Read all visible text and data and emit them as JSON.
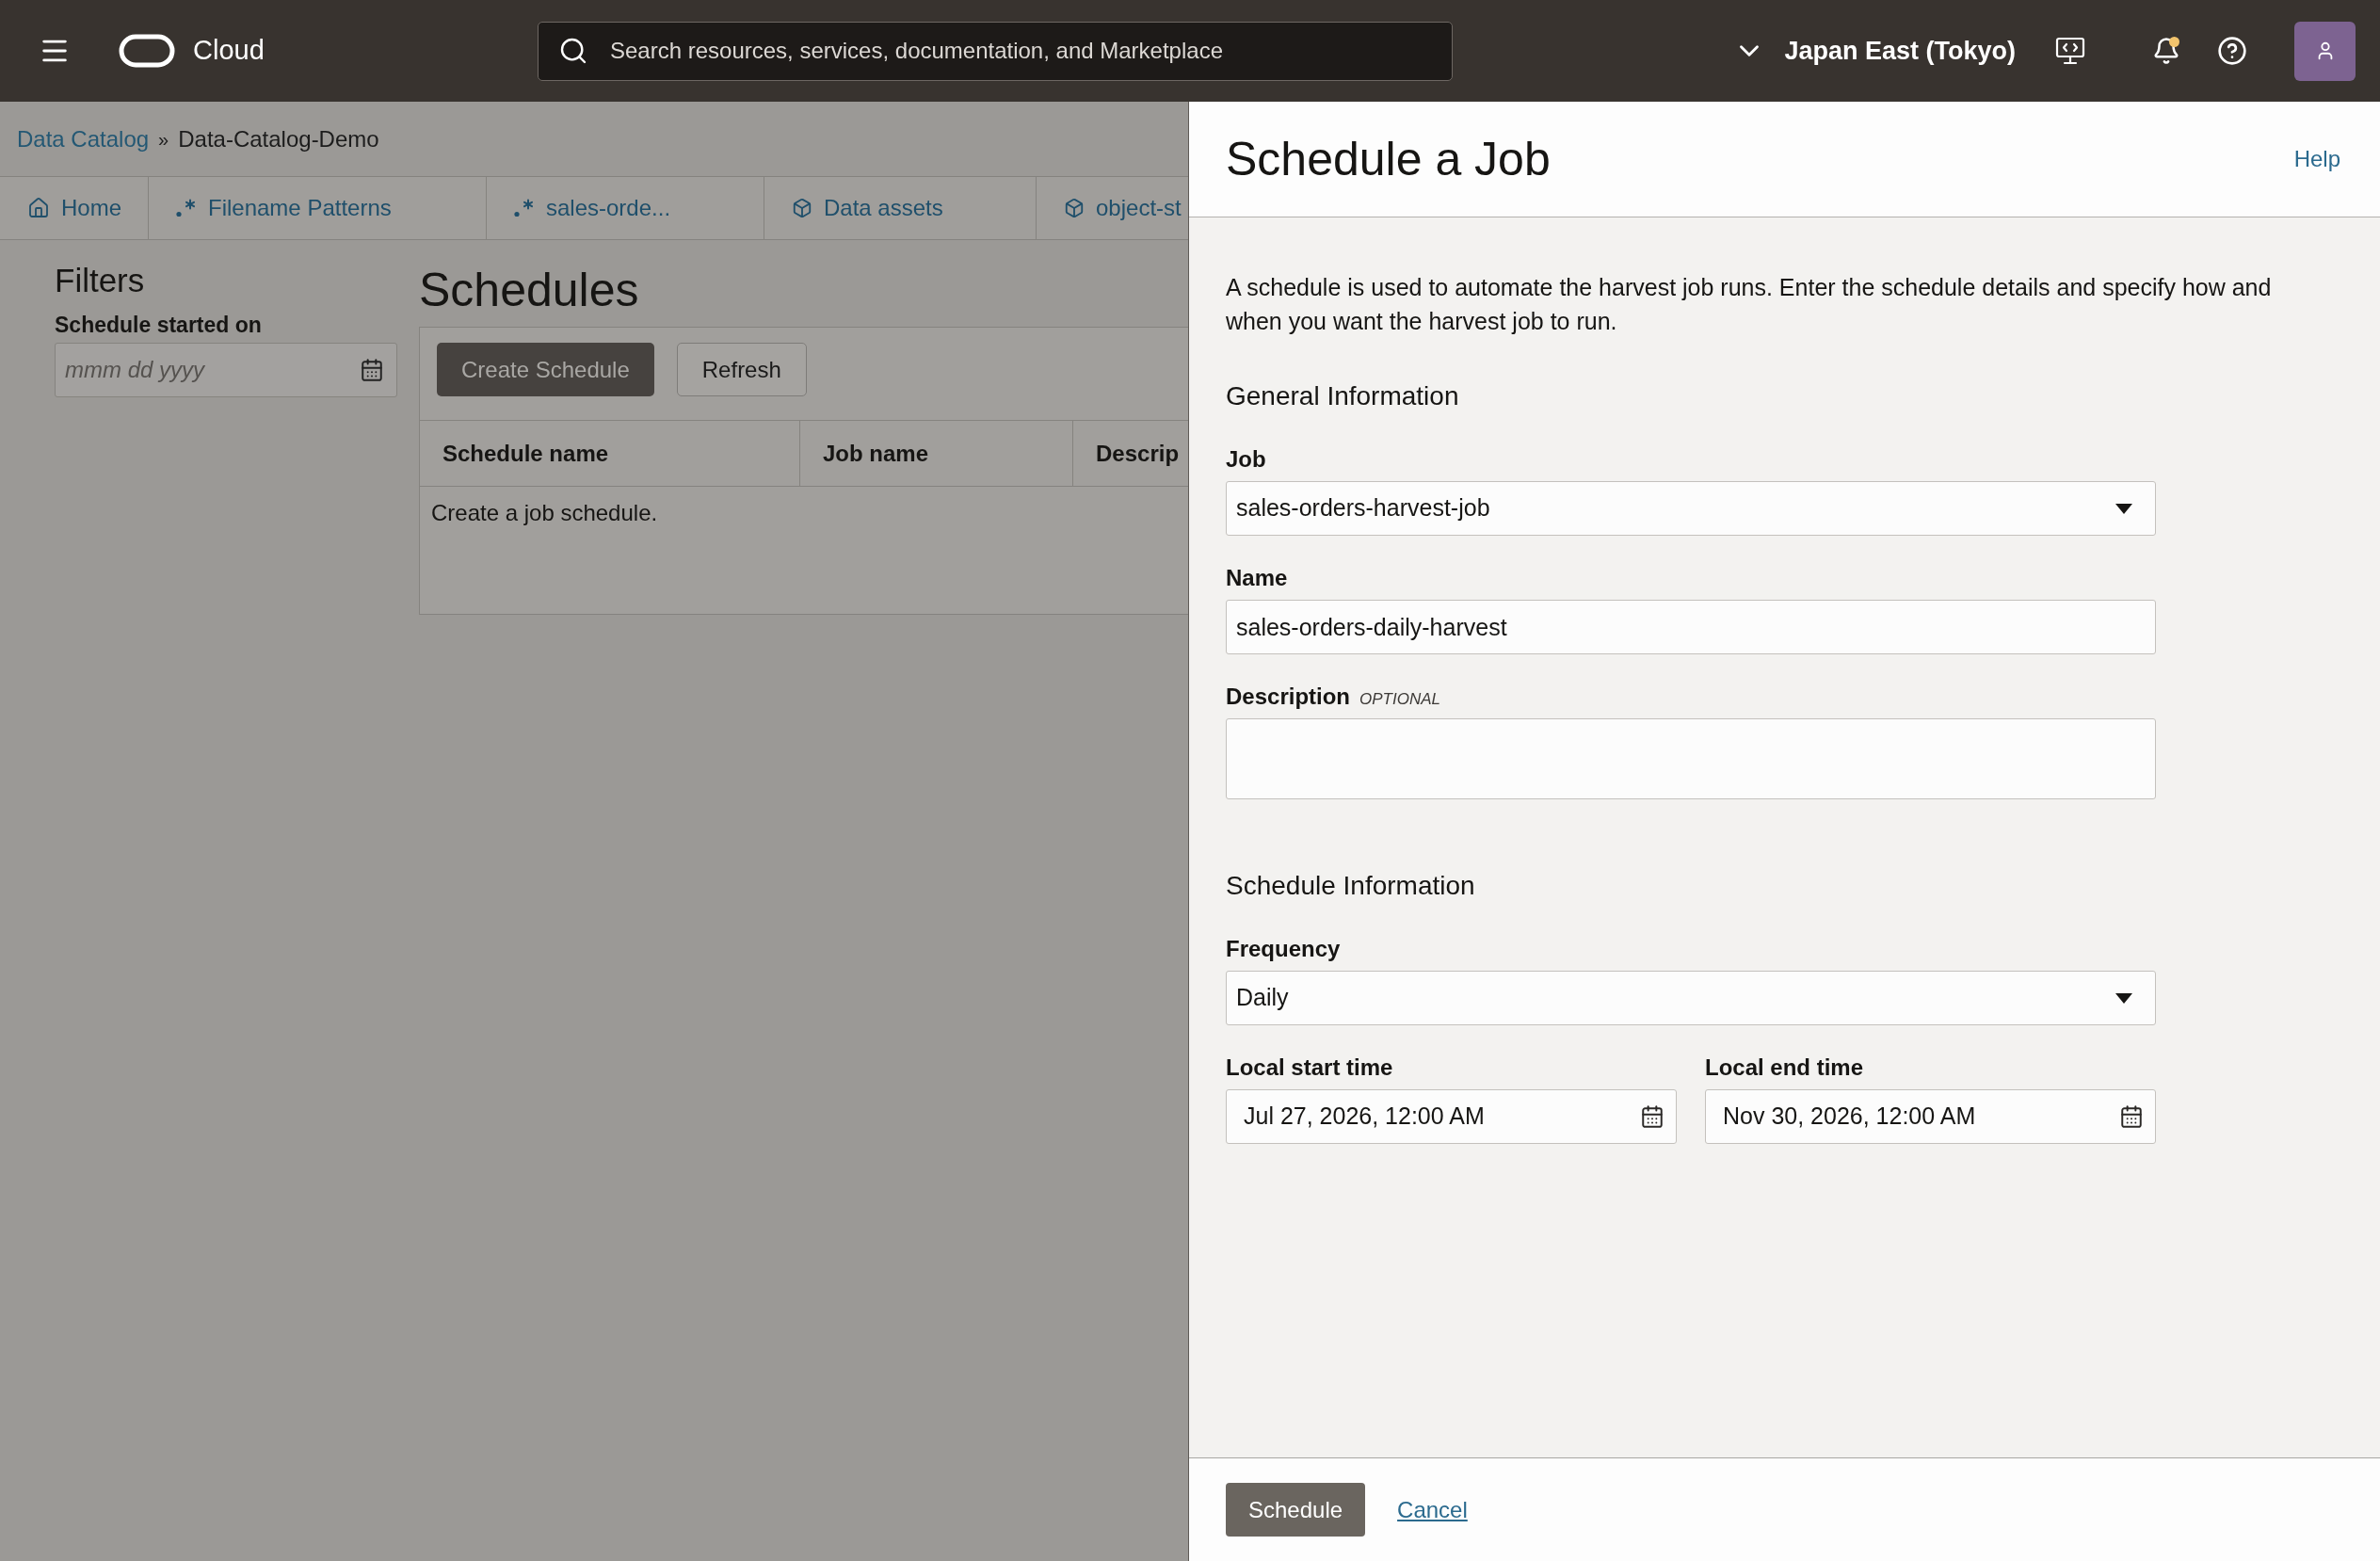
{
  "top_bar": {
    "brand": "Cloud",
    "search": {
      "placeholder": "Search resources, services, documentation, and Marketplace"
    },
    "region": "Japan East (Tokyo)",
    "has_notifications": true
  },
  "breadcrumb": {
    "items": [
      {
        "label": "Data Catalog",
        "link": true
      },
      {
        "label": "Data-Catalog-Demo",
        "link": false
      }
    ],
    "separator": "»"
  },
  "tabs": [
    {
      "label": "Home",
      "kind": "home",
      "selected": false
    },
    {
      "label": "Filename Patterns",
      "kind": "pattern",
      "selected": false
    },
    {
      "label": "sales-orde...",
      "kind": "pattern",
      "selected": false
    },
    {
      "label": "Data assets",
      "kind": "cube",
      "selected": false
    },
    {
      "label": "object-st",
      "kind": "cube",
      "selected": false
    }
  ],
  "filters": {
    "title": "Filters",
    "fields": [
      {
        "label": "Schedule started on",
        "placeholder": "mmm dd yyyy"
      }
    ]
  },
  "schedules": {
    "title": "Schedules",
    "buttons": [
      {
        "label": "Create Schedule",
        "kind": "primary"
      },
      {
        "label": "Refresh",
        "kind": "secondary"
      }
    ],
    "table": {
      "columns": [
        "Schedule name",
        "Job name",
        "Descrip"
      ],
      "empty_message": "Create a job schedule."
    }
  },
  "panel": {
    "title": "Schedule a Job",
    "help": "Help",
    "intro": "A schedule is used to automate the harvest job runs. Enter the schedule details and specify how and when you want the harvest job to run.",
    "sections": [
      {
        "heading": "General Information",
        "fields": [
          {
            "kind": "select",
            "label": "Job",
            "value": "sales-orders-harvest-job"
          },
          {
            "kind": "text",
            "label": "Name",
            "value": "sales-orders-daily-harvest"
          },
          {
            "kind": "textarea",
            "label": "Description",
            "tag": "OPTIONAL"
          }
        ]
      },
      {
        "heading": "Schedule Information",
        "fields": [
          {
            "kind": "select",
            "label": "Frequency",
            "value": "Daily"
          },
          {
            "kind": "datetime",
            "label": "Local start time",
            "value": "Jul 27, 2026, 12:00 AM"
          },
          {
            "kind": "datetime",
            "label": "Local end time",
            "value": "Nov 30, 2026, 12:00 AM"
          }
        ]
      }
    ],
    "actions": [
      {
        "label": "Schedule",
        "kind": "button"
      },
      {
        "label": "Cancel",
        "kind": "link"
      }
    ]
  }
}
